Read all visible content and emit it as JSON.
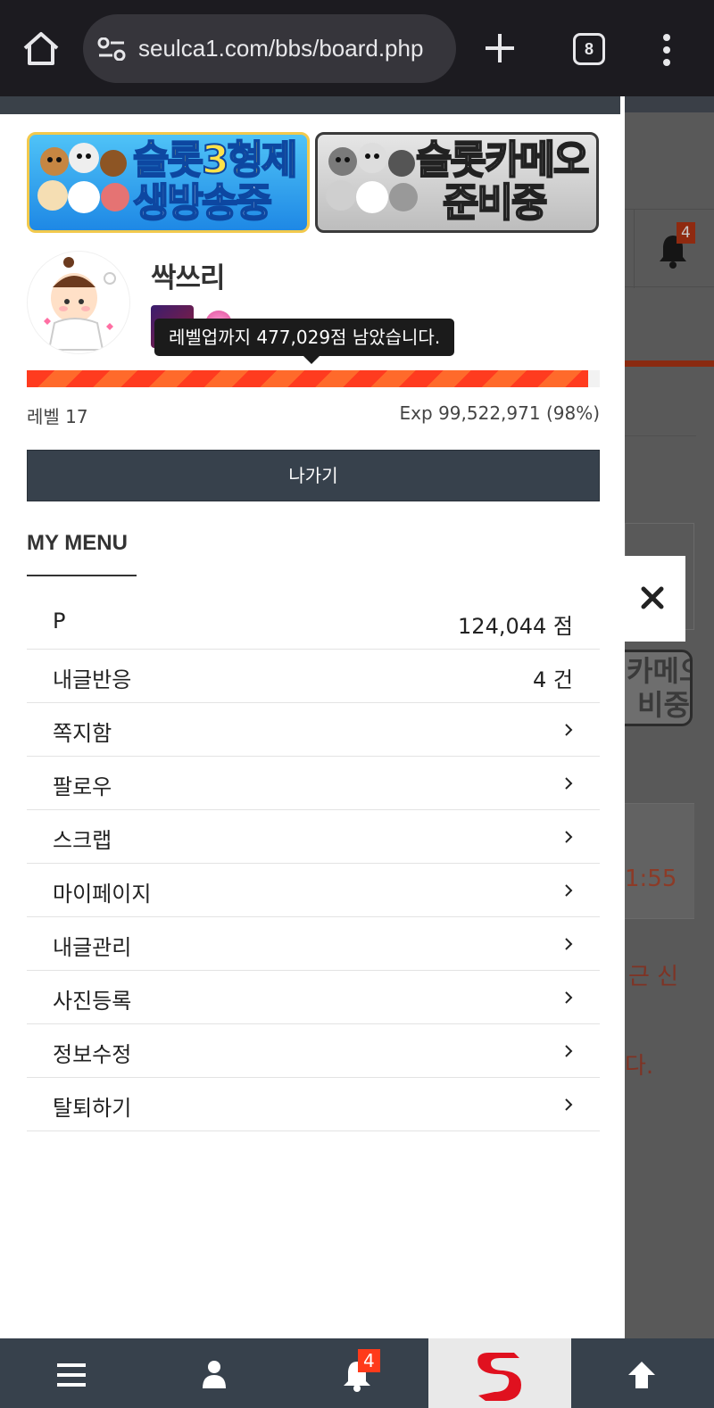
{
  "browser": {
    "url": "seulca1.com/bbs/board.php",
    "tab_count": "8"
  },
  "banners": [
    {
      "line1": "슬롯3형제",
      "line2": "생방송중"
    },
    {
      "line1": "슬롯카메오",
      "line2": "준비중"
    }
  ],
  "profile": {
    "nickname": "싹쓰리",
    "tooltip": "레벨업까지 477,029점 남았습니다.",
    "level_label": "레벨 17",
    "exp_label": "Exp 99,522,971 (98%)",
    "exp_percent": 98,
    "logout_label": "나가기"
  },
  "menu": {
    "title": "MY MENU",
    "items": [
      {
        "label": "P",
        "value": "124,044 점"
      },
      {
        "label": "내글반응",
        "value": "4 건"
      },
      {
        "label": "쪽지함"
      },
      {
        "label": "팔로우"
      },
      {
        "label": "스크랩"
      },
      {
        "label": "마이페이지"
      },
      {
        "label": "내글관리"
      },
      {
        "label": "사진등록"
      },
      {
        "label": "정보수정"
      },
      {
        "label": "탈퇴하기"
      }
    ]
  },
  "background_page": {
    "notification_count": "4",
    "banner_text_line1": "카메오",
    "banner_text_line2": "비중",
    "time_fragment": "1:55",
    "text_fragment_1": "근 신",
    "text_fragment_2": "다."
  },
  "bottom_nav": {
    "notification_count": "4"
  },
  "colors": {
    "accent": "#ff3b1f",
    "nav_bg": "#37414c"
  }
}
